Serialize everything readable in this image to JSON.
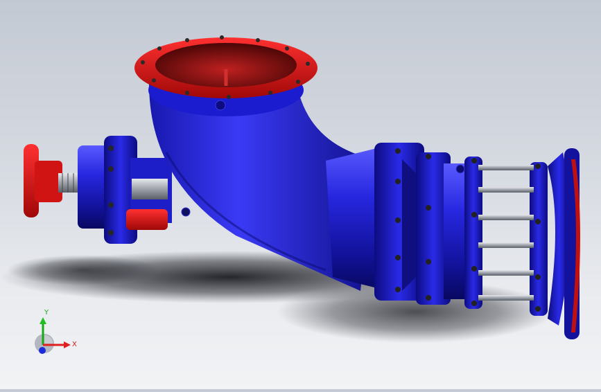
{
  "viewport": {
    "model": "axial-flow-pump-assembly",
    "colors": {
      "body_blue": "#1f1fd8",
      "body_dark": "#0a0a7a",
      "flange_red": "#e01010",
      "interior_red": "#8a1010",
      "steel": "#b8bcc4",
      "background_top": "#c3c9d3",
      "background_bottom": "#f2f3f5"
    }
  },
  "triad": {
    "x_label": "X",
    "y_label": "Y",
    "colors": {
      "x": "#e02020",
      "y": "#20c020",
      "z": "#2030e0"
    }
  }
}
